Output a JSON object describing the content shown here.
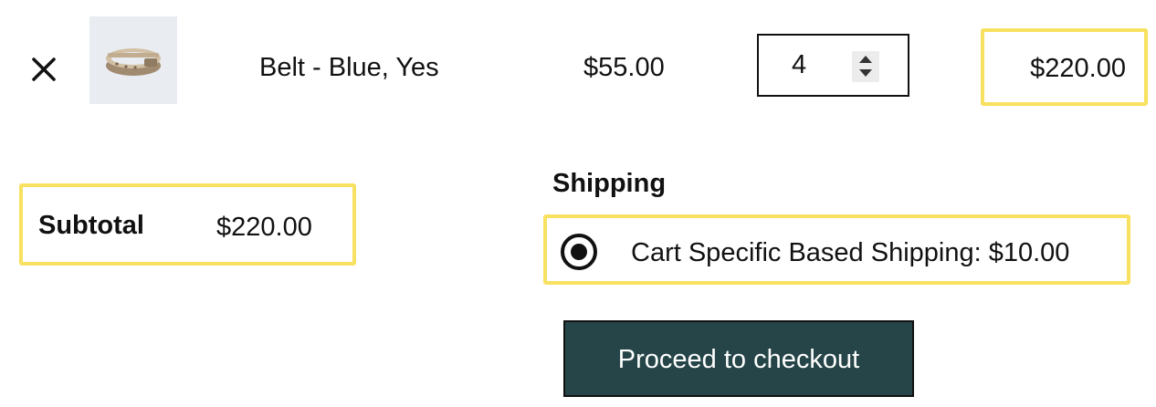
{
  "cart_item": {
    "remove_icon": "close-icon",
    "thumbnail_icon": "belt-image",
    "name": "Belt - Blue, Yes",
    "price": "$55.00",
    "quantity": "4",
    "line_total": "$220.00"
  },
  "totals": {
    "subtotal_label": "Subtotal",
    "subtotal_value": "$220.00",
    "shipping_heading": "Shipping",
    "shipping_option": "Cart Specific Based Shipping: $10.00",
    "shipping_selected": true
  },
  "checkout": {
    "label": "Proceed to checkout"
  },
  "colors": {
    "highlight": "#f8e160",
    "checkout_bg": "#264548",
    "thumbnail_bg": "#e9ecf1"
  }
}
